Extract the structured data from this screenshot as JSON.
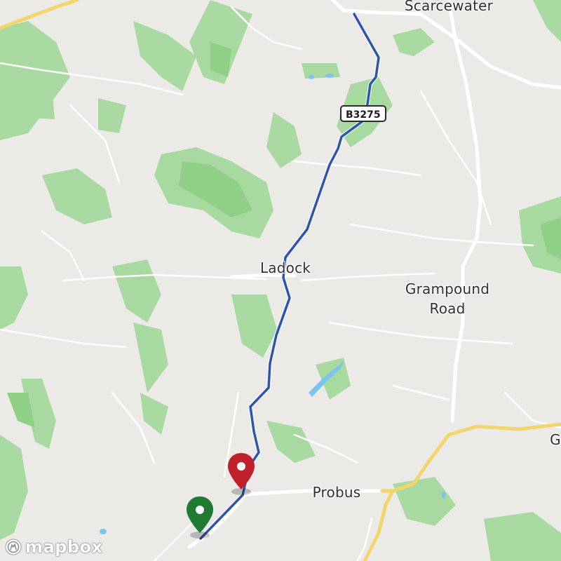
{
  "map": {
    "colors": {
      "land": "#eceae7",
      "green": "#a8d9a0",
      "green_dark": "#8fcf86",
      "water": "#7cc4ec",
      "road_white": "#ffffff",
      "road_yellow": "#f2d56b",
      "route": "#2f55a8",
      "marker_start": "#1f7a33",
      "marker_end": "#c0202b"
    },
    "places": {
      "scarcewater": "Scarcewater",
      "ladock": "Ladock",
      "grampound_road_line1": "Grampound",
      "grampound_road_line2": "Road",
      "probus": "Probus",
      "edge_g": "G"
    },
    "road_shield": "B3275",
    "markers": {
      "start_icon": "location-pin-green",
      "end_icon": "location-pin-red"
    },
    "attribution": {
      "logo_text": "mapbox",
      "logo_icon": "mapbox-logo-icon"
    }
  }
}
